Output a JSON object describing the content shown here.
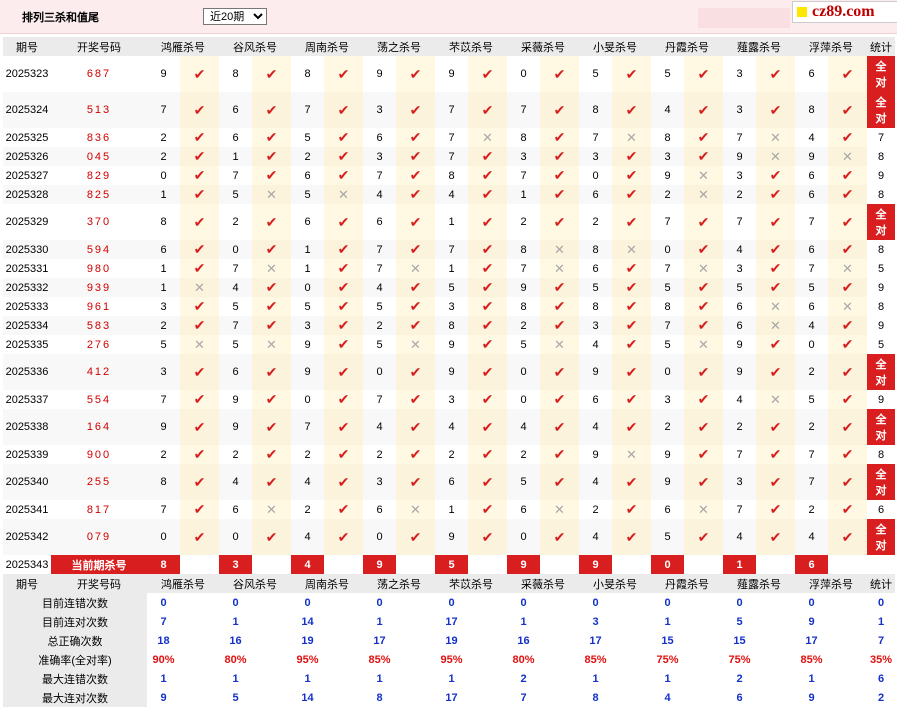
{
  "header": {
    "title": "排列三杀和值尾",
    "period_select": {
      "value": "近20期",
      "options": [
        "近20期"
      ]
    },
    "logo_text": "cz89.com"
  },
  "columns": {
    "issue": "期号",
    "number": "开奖号码",
    "predictors": [
      "鸿雁杀号",
      "谷风杀号",
      "周南杀号",
      "荡之杀号",
      "芣苡杀号",
      "采薇杀号",
      "小旻杀号",
      "丹霞杀号",
      "薤露杀号",
      "浮萍杀号"
    ],
    "stats": "统计"
  },
  "rows": [
    {
      "issue": "2025323",
      "number": "687",
      "preds": [
        9,
        8,
        8,
        9,
        9,
        0,
        5,
        5,
        3,
        6
      ],
      "marks": [
        "v",
        "v",
        "v",
        "v",
        "v",
        "v",
        "v",
        "v",
        "v",
        "v"
      ],
      "stat": "全对"
    },
    {
      "issue": "2025324",
      "number": "513",
      "preds": [
        7,
        6,
        7,
        3,
        7,
        7,
        8,
        4,
        3,
        8
      ],
      "marks": [
        "v",
        "v",
        "v",
        "v",
        "v",
        "v",
        "v",
        "v",
        "v",
        "v"
      ],
      "stat": "全对"
    },
    {
      "issue": "2025325",
      "number": "836",
      "preds": [
        2,
        6,
        5,
        6,
        7,
        8,
        7,
        8,
        7,
        4
      ],
      "marks": [
        "v",
        "v",
        "v",
        "v",
        "x",
        "v",
        "x",
        "v",
        "x",
        "v"
      ],
      "stat": "7"
    },
    {
      "issue": "2025326",
      "number": "045",
      "preds": [
        2,
        1,
        2,
        3,
        7,
        3,
        3,
        3,
        9,
        9
      ],
      "marks": [
        "v",
        "v",
        "v",
        "v",
        "v",
        "v",
        "v",
        "v",
        "x",
        "x"
      ],
      "stat": "8"
    },
    {
      "issue": "2025327",
      "number": "829",
      "preds": [
        0,
        7,
        6,
        7,
        8,
        7,
        0,
        9,
        3,
        6
      ],
      "marks": [
        "v",
        "v",
        "v",
        "v",
        "v",
        "v",
        "v",
        "x",
        "v",
        "v"
      ],
      "stat": "9"
    },
    {
      "issue": "2025328",
      "number": "825",
      "preds": [
        1,
        5,
        5,
        4,
        4,
        1,
        6,
        2,
        2,
        6
      ],
      "marks": [
        "v",
        "x",
        "x",
        "v",
        "v",
        "v",
        "v",
        "x",
        "v",
        "v"
      ],
      "stat": "8"
    },
    {
      "issue": "2025329",
      "number": "370",
      "preds": [
        8,
        2,
        6,
        6,
        1,
        2,
        2,
        7,
        7,
        7
      ],
      "marks": [
        "v",
        "v",
        "v",
        "v",
        "v",
        "v",
        "v",
        "v",
        "v",
        "v"
      ],
      "stat": "全对"
    },
    {
      "issue": "2025330",
      "number": "594",
      "preds": [
        6,
        0,
        1,
        7,
        7,
        8,
        8,
        0,
        4,
        6
      ],
      "marks": [
        "v",
        "v",
        "v",
        "v",
        "v",
        "x",
        "x",
        "v",
        "v",
        "v"
      ],
      "stat": "8"
    },
    {
      "issue": "2025331",
      "number": "980",
      "preds": [
        1,
        7,
        1,
        7,
        1,
        7,
        6,
        7,
        3,
        7
      ],
      "marks": [
        "v",
        "x",
        "v",
        "x",
        "v",
        "x",
        "v",
        "x",
        "v",
        "x"
      ],
      "stat": "5"
    },
    {
      "issue": "2025332",
      "number": "939",
      "preds": [
        1,
        4,
        0,
        4,
        5,
        9,
        5,
        5,
        5,
        5
      ],
      "marks": [
        "x",
        "v",
        "v",
        "v",
        "v",
        "v",
        "v",
        "v",
        "v",
        "v"
      ],
      "stat": "9"
    },
    {
      "issue": "2025333",
      "number": "961",
      "preds": [
        3,
        5,
        5,
        5,
        3,
        8,
        8,
        8,
        6,
        6
      ],
      "marks": [
        "v",
        "v",
        "v",
        "v",
        "v",
        "v",
        "v",
        "v",
        "x",
        "x"
      ],
      "stat": "8"
    },
    {
      "issue": "2025334",
      "number": "583",
      "preds": [
        2,
        7,
        3,
        2,
        8,
        2,
        3,
        7,
        6,
        4
      ],
      "marks": [
        "v",
        "v",
        "v",
        "v",
        "v",
        "v",
        "v",
        "v",
        "x",
        "v"
      ],
      "stat": "9"
    },
    {
      "issue": "2025335",
      "number": "276",
      "preds": [
        5,
        5,
        9,
        5,
        9,
        5,
        4,
        5,
        9,
        0
      ],
      "marks": [
        "x",
        "x",
        "v",
        "x",
        "v",
        "x",
        "v",
        "x",
        "v",
        "v"
      ],
      "stat": "5"
    },
    {
      "issue": "2025336",
      "number": "412",
      "preds": [
        3,
        6,
        9,
        0,
        9,
        0,
        9,
        0,
        9,
        2
      ],
      "marks": [
        "v",
        "v",
        "v",
        "v",
        "v",
        "v",
        "v",
        "v",
        "v",
        "v"
      ],
      "stat": "全对"
    },
    {
      "issue": "2025337",
      "number": "554",
      "preds": [
        7,
        9,
        0,
        7,
        3,
        0,
        6,
        3,
        4,
        5
      ],
      "marks": [
        "v",
        "v",
        "v",
        "v",
        "v",
        "v",
        "v",
        "v",
        "x",
        "v"
      ],
      "stat": "9"
    },
    {
      "issue": "2025338",
      "number": "164",
      "preds": [
        9,
        9,
        7,
        4,
        4,
        4,
        4,
        2,
        2,
        2
      ],
      "marks": [
        "v",
        "v",
        "v",
        "v",
        "v",
        "v",
        "v",
        "v",
        "v",
        "v"
      ],
      "stat": "全对"
    },
    {
      "issue": "2025339",
      "number": "900",
      "preds": [
        2,
        2,
        2,
        2,
        2,
        2,
        9,
        9,
        7,
        7
      ],
      "marks": [
        "v",
        "v",
        "v",
        "v",
        "v",
        "v",
        "x",
        "v",
        "v",
        "v"
      ],
      "stat": "8"
    },
    {
      "issue": "2025340",
      "number": "255",
      "preds": [
        8,
        4,
        4,
        3,
        6,
        5,
        4,
        9,
        3,
        7
      ],
      "marks": [
        "v",
        "v",
        "v",
        "v",
        "v",
        "v",
        "v",
        "v",
        "v",
        "v"
      ],
      "stat": "全对"
    },
    {
      "issue": "2025341",
      "number": "817",
      "preds": [
        7,
        6,
        2,
        6,
        1,
        6,
        2,
        6,
        7,
        2
      ],
      "marks": [
        "v",
        "x",
        "v",
        "x",
        "v",
        "x",
        "v",
        "x",
        "v",
        "v"
      ],
      "stat": "6"
    },
    {
      "issue": "2025342",
      "number": "079",
      "preds": [
        0,
        0,
        4,
        0,
        9,
        0,
        4,
        5,
        4,
        4
      ],
      "marks": [
        "v",
        "v",
        "v",
        "v",
        "v",
        "v",
        "v",
        "v",
        "v",
        "v"
      ],
      "stat": "全对"
    }
  ],
  "current": {
    "issue": "2025343",
    "label": "当前期杀号",
    "preds": [
      8,
      3,
      4,
      9,
      5,
      9,
      9,
      0,
      1,
      6
    ]
  },
  "stats": {
    "rows": [
      {
        "label": "目前连错次数",
        "values": [
          "0",
          "0",
          "0",
          "0",
          "0",
          "0",
          "0",
          "0",
          "0",
          "0"
        ],
        "total": "0"
      },
      {
        "label": "目前连对次数",
        "values": [
          "7",
          "1",
          "14",
          "1",
          "17",
          "1",
          "3",
          "1",
          "5",
          "9"
        ],
        "total": "1"
      },
      {
        "label": "总正确次数",
        "values": [
          "18",
          "16",
          "19",
          "17",
          "19",
          "16",
          "17",
          "15",
          "15",
          "17"
        ],
        "total": "7"
      },
      {
        "label": "准确率(全对率)",
        "values": [
          "90%",
          "80%",
          "95%",
          "85%",
          "95%",
          "80%",
          "85%",
          "75%",
          "75%",
          "85%"
        ],
        "total": "35%",
        "is_rate": true
      },
      {
        "label": "最大连错次数",
        "values": [
          "1",
          "1",
          "1",
          "1",
          "1",
          "2",
          "1",
          "1",
          "2",
          "1"
        ],
        "total": "6"
      },
      {
        "label": "最大连对次数",
        "values": [
          "9",
          "5",
          "14",
          "8",
          "17",
          "7",
          "8",
          "4",
          "6",
          "9"
        ],
        "total": "2"
      }
    ]
  },
  "colors": {
    "accent_red": "#d81e1e",
    "stat_blue": "#1432c8",
    "header_gray": "#ebebeb",
    "mark_bg": "#fff9e4"
  },
  "icons": {
    "correct": "check-icon",
    "wrong": "cross-icon"
  }
}
